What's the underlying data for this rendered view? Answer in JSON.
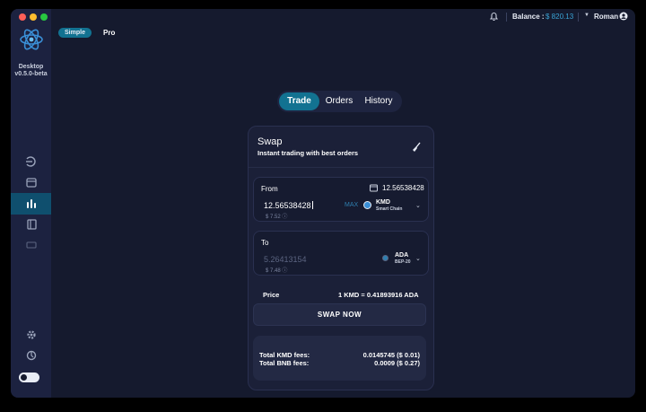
{
  "app": {
    "name_line1": "Desktop",
    "name_line2": "v0.5.0-beta"
  },
  "topbar": {
    "balance_label": "Balance :",
    "balance_value": "$ 820.13",
    "user_name": "Roman"
  },
  "modes": {
    "simple": "Simple",
    "pro": "Pro"
  },
  "tabs": {
    "trade": "Trade",
    "orders": "Orders",
    "history": "History"
  },
  "swap": {
    "title": "Swap",
    "subtitle": "Instant trading with best orders",
    "from": {
      "label": "From",
      "balance": "12.56538428",
      "amount": "12.56538428",
      "fiat": "$ 7.52",
      "max_label": "MAX",
      "coin": "KMD",
      "network": "Smart Chain"
    },
    "to": {
      "label": "To",
      "amount": "5.26413154",
      "fiat": "$ 7.48",
      "coin": "ADA",
      "network": "BEP-20"
    },
    "price_label": "Price",
    "price_value": "1 KMD = 0.41893916 ADA",
    "button": "SWAP NOW",
    "fees": [
      {
        "label": "Total KMD fees:",
        "value": "0.0145745 ($ 0.01)"
      },
      {
        "label": "Total BNB fees:",
        "value": "0.0009 ($ 0.27)"
      }
    ]
  },
  "colors": {
    "accent": "#127291",
    "balance": "#3aa4d6",
    "background": "#151a2e",
    "sidebar": "#1c2240"
  },
  "icons": [
    "bell-icon",
    "user-icon",
    "dex-icon",
    "wallet-icon",
    "trade-icon",
    "address-book-icon",
    "fiat-icon",
    "settings-icon",
    "support-icon",
    "broom-icon",
    "theme-toggle"
  ]
}
